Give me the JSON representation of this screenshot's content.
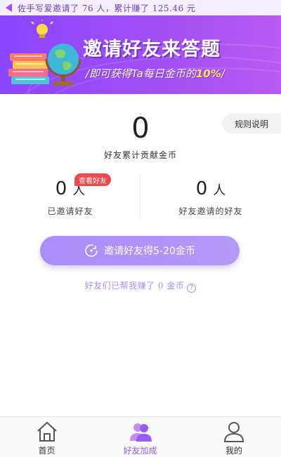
{
  "ticker": {
    "text": "佐手写爱邀请了 76 人，累计赚了 125.46 元"
  },
  "banner": {
    "title": "邀请好友来答题",
    "subtitle_prefix": "/即可获得Ta每日金币的",
    "subtitle_highlight": "10%",
    "subtitle_suffix": "/"
  },
  "summary": {
    "total_value": "0",
    "total_label": "好友累计贡献金币",
    "rules_label": "规则说明"
  },
  "stats": {
    "invited": {
      "value": "0",
      "unit": "人",
      "label": "已邀请好友"
    },
    "friends_invited": {
      "value": "0",
      "unit": "人",
      "label": "好友邀请的好友"
    },
    "view_badge": "查看好友"
  },
  "invite": {
    "button_label": "邀请好友得5-20金币",
    "earned_text": "好友们已帮我赚了 0 金币"
  },
  "tabs": [
    {
      "label": "首页",
      "icon": "home-icon"
    },
    {
      "label": "好友加成",
      "icon": "friends-icon"
    },
    {
      "label": "我的",
      "icon": "user-icon"
    }
  ],
  "colors": {
    "accent": "#9b5bf2",
    "button": "#a98dfb",
    "badge": "#f0484f",
    "highlight": "#ffe45a"
  }
}
